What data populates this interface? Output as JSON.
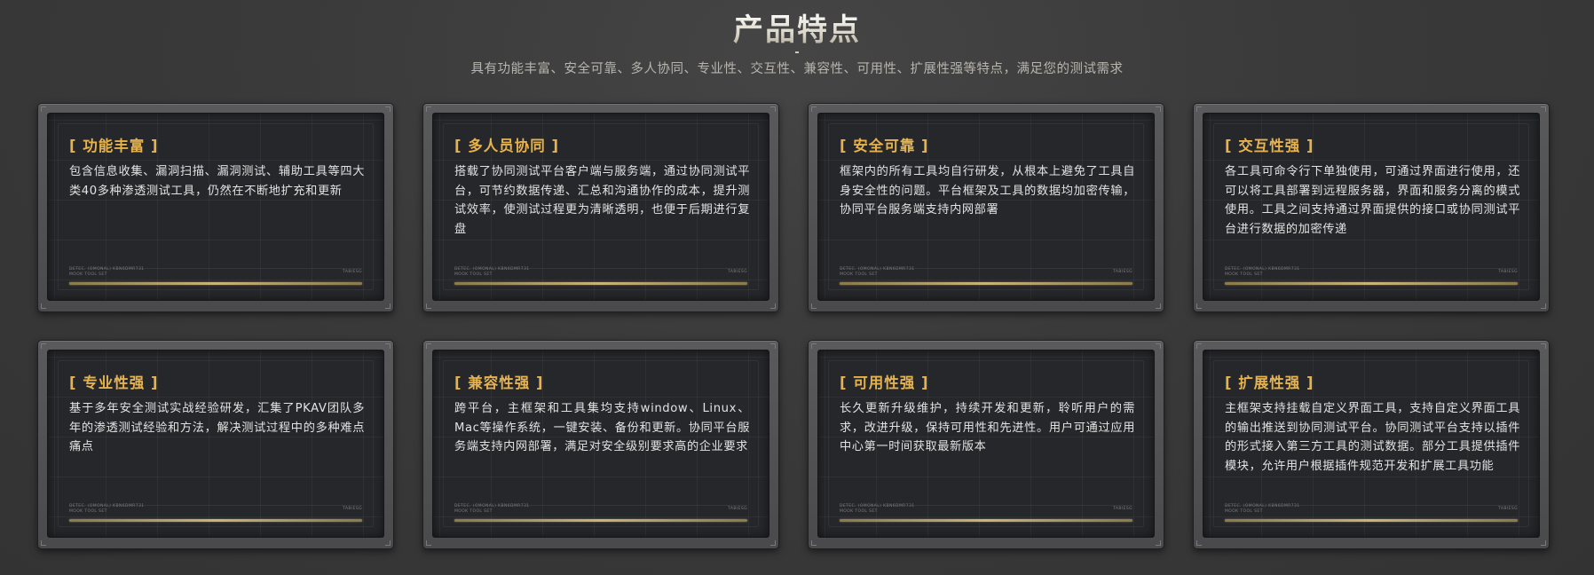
{
  "header": {
    "title": "产品特点",
    "subtitle": "具有功能丰富、安全可靠、多人协同、专业性、交互性、兼容性、可用性、扩展性强等特点，满足您的测试需求"
  },
  "cards": [
    {
      "title": "[ 功能丰富 ]",
      "text": "包含信息收集、漏洞扫描、漏洞测试、辅助工具等四大类40多种渗透测试工具，仍然在不断地扩充和更新",
      "micro_left": "DETEC. (OMONAL) KBN6DMR731\nMOOK TOOL SET",
      "micro_right": "TABIESG"
    },
    {
      "title": "[ 多人员协同 ]",
      "text": "搭载了协同测试平台客户端与服务端，通过协同测试平台，可节约数据传递、汇总和沟通协作的成本，提升测试效率，使测试过程更为清晰透明，也便于后期进行复盘",
      "micro_left": "DETEC. (OMONAL) KBN6DMR731\nMOOK TOOL SET",
      "micro_right": "TABIESG"
    },
    {
      "title": "[ 安全可靠 ]",
      "text": "框架内的所有工具均自行研发，从根本上避免了工具自身安全性的问题。平台框架及工具的数据均加密传输，协同平台服务端支持内网部署",
      "micro_left": "DETEC. (OMONAL) KBN6DMR731\nMOOK TOOL SET",
      "micro_right": "TABIESG"
    },
    {
      "title": "[ 交互性强 ]",
      "text": "各工具可命令行下单独使用，可通过界面进行使用，还可以将工具部署到远程服务器，界面和服务分离的模式使用。工具之间支持通过界面提供的接口或协同测试平台进行数据的加密传递",
      "micro_left": "DETEC. (OMONAL) KBN6DMR731\nMOOK TOOL SET",
      "micro_right": "TABIESG"
    },
    {
      "title": "[ 专业性强 ]",
      "text": "基于多年安全测试实战经验研发，汇集了PKAV团队多年的渗透测试经验和方法，解决测试过程中的多种难点痛点",
      "micro_left": "DETEC. (OMONAL) KBN6DMR731\nMOOK TOOL SET",
      "micro_right": "TABIESG"
    },
    {
      "title": "[ 兼容性强 ]",
      "text": "跨平台，主框架和工具集均支持window、Linux、Mac等操作系统，一键安装、备份和更新。协同平台服务端支持内网部署，满足对安全级别要求高的企业要求",
      "micro_left": "DETEC. (OMONAL) KBN6DMR731\nMOOK TOOL SET",
      "micro_right": "TABIESG"
    },
    {
      "title": "[ 可用性强 ]",
      "text": "长久更新升级维护，持续开发和更新，聆听用户的需求，改进升级，保持可用性和先进性。用户可通过应用中心第一时间获取最新版本",
      "micro_left": "DETEC. (OMONAL) KBN6DMR731\nMOOK TOOL SET",
      "micro_right": "TABIESG"
    },
    {
      "title": "[ 扩展性强 ]",
      "text": "主框架支持挂载自定义界面工具，支持自定义界面工具的输出推送到协同测试平台。协同测试平台支持以插件的形式接入第三方工具的测试数据。部分工具提供插件模块，允许用户根据插件规范开发和扩展工具功能",
      "micro_left": "DETEC. (OMONAL) KBN6DMR731\nMOOK TOOL SET",
      "micro_right": "TABIESG"
    }
  ]
}
